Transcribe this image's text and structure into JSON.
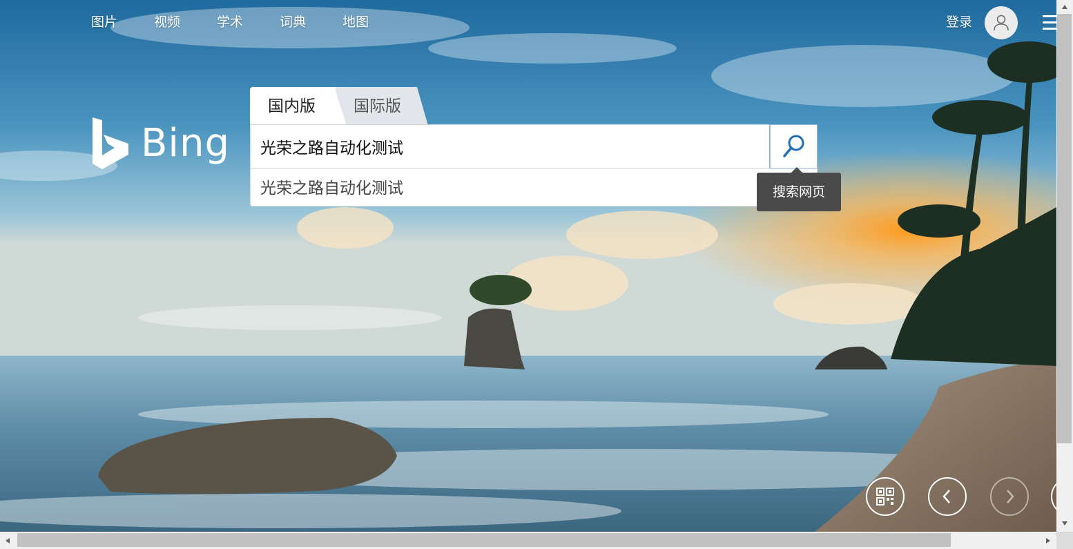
{
  "nav": {
    "links": [
      "图片",
      "视频",
      "学术",
      "词典",
      "地图"
    ],
    "login": "登录"
  },
  "logo": {
    "text": "Bing"
  },
  "search": {
    "tabs": [
      "国内版",
      "国际版"
    ],
    "query": "光荣之路自动化测试",
    "suggestion": "光荣之路自动化测试",
    "tooltip": "搜索网页"
  },
  "icons": {
    "avatar": "user-icon",
    "menu": "hamburger-icon",
    "search": "search-icon",
    "qr": "qr-code-icon",
    "prev": "chevron-left-icon",
    "next": "chevron-right-icon"
  },
  "colors": {
    "search_icon": "#1e6fb4",
    "tooltip_bg": "#4a4a4a",
    "tab_inactive": "#e2e6ea"
  }
}
